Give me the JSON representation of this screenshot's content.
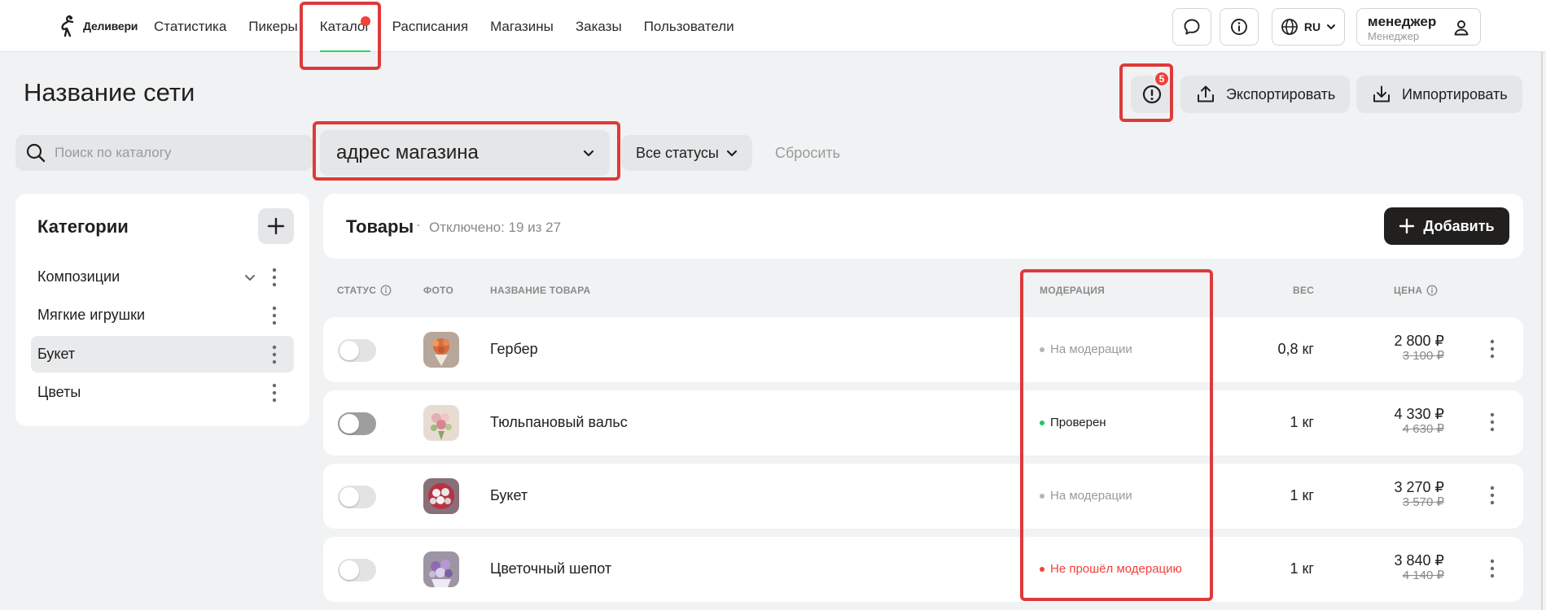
{
  "brand": {
    "name": "Деливери"
  },
  "nav": [
    {
      "label": "Статистика"
    },
    {
      "label": "Пикеры"
    },
    {
      "label": "Каталог",
      "active": true
    },
    {
      "label": "Расписания"
    },
    {
      "label": "Магазины"
    },
    {
      "label": "Заказы"
    },
    {
      "label": "Пользователи"
    }
  ],
  "header": {
    "icons": [
      "chat-icon",
      "info-icon",
      "globe-icon"
    ],
    "lang": "RU",
    "user": {
      "name": "менеджер",
      "role": "Менеджер"
    }
  },
  "page": {
    "title": "Название сети"
  },
  "actions": {
    "warnings_count": "5",
    "export_label": "Экспортировать",
    "import_label": "Импортировать"
  },
  "filters": {
    "search_placeholder": "Поиск по каталогу",
    "store_select": "адрес магазина",
    "status_select": "Все статусы",
    "reset_label": "Сбросить"
  },
  "categories": {
    "title": "Категории",
    "items": [
      {
        "label": "Композиции",
        "expandable": true,
        "selected": false
      },
      {
        "label": "Мягкие игрушки",
        "selected": false
      },
      {
        "label": "Букет",
        "selected": true
      },
      {
        "label": "Цветы",
        "selected": false
      }
    ]
  },
  "products": {
    "title": "Товары",
    "subtitle": "Отключено: 19 из 27",
    "add_label": "Добавить",
    "columns": {
      "status": "СТАТУС",
      "photo": "ФОТО",
      "name": "НАЗВАНИЕ ТОВАРА",
      "moderation": "МОДЕРАЦИЯ",
      "weight": "ВЕС",
      "price": "ЦЕНА"
    },
    "rows": [
      {
        "name": "Гербер",
        "enabled": false,
        "moderation": "На модерации",
        "moderation_color": "#9a9a9a",
        "weight": "0,8 кг",
        "price": "2 800 ₽",
        "old_price": "3 100 ₽"
      },
      {
        "name": "Тюльпановый вальс",
        "enabled": true,
        "moderation": "Проверен",
        "moderation_color": "#21201f",
        "weight": "1 кг",
        "price": "4 330 ₽",
        "old_price": "4 630 ₽"
      },
      {
        "name": "Букет",
        "enabled": false,
        "moderation": "На модерации",
        "moderation_color": "#9a9a9a",
        "weight": "1 кг",
        "price": "3 270 ₽",
        "old_price": "3 570 ₽"
      },
      {
        "name": "Цветочный шепот",
        "enabled": false,
        "moderation": "Не прошёл модерацию",
        "moderation_color": "#f0413b",
        "weight": "1 кг",
        "price": "3 840 ₽",
        "old_price": "4 140 ₽"
      }
    ]
  },
  "colors": {
    "accent_nav": "#2fd36a",
    "error": "#f0413b",
    "ok": "#22c55e",
    "highlight": "#dd3a3a",
    "dark_button": "#21201f"
  }
}
